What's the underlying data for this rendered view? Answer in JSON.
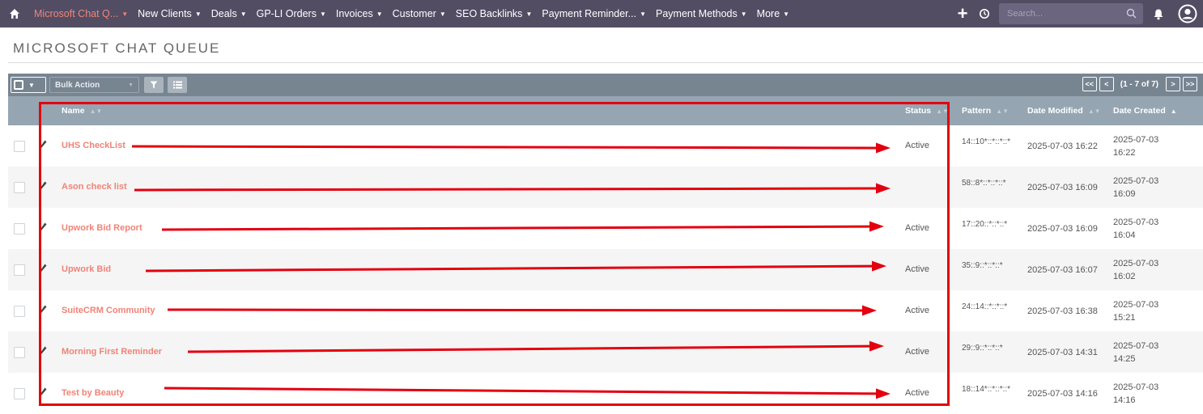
{
  "nav": {
    "items": [
      {
        "label": "Microsoft Chat Q...",
        "active": true
      },
      {
        "label": "New Clients"
      },
      {
        "label": "Deals"
      },
      {
        "label": "GP-LI Orders"
      },
      {
        "label": "Invoices"
      },
      {
        "label": "Customer"
      },
      {
        "label": "SEO Backlinks"
      },
      {
        "label": "Payment Reminder..."
      },
      {
        "label": "Payment Methods"
      },
      {
        "label": "More"
      }
    ],
    "search_placeholder": "Search..."
  },
  "page": {
    "title": "MICROSOFT CHAT QUEUE"
  },
  "toolbar": {
    "bulk_action_label": "Bulk Action",
    "pagination": {
      "first": "<<",
      "prev": "<",
      "count": "(1 - 7 of 7)",
      "next": ">",
      "last": ">>"
    }
  },
  "table": {
    "columns": [
      "Name",
      "Status",
      "Pattern",
      "Date Modified",
      "Date Created"
    ],
    "sorted_column": "Date Created",
    "rows": [
      {
        "name": "UHS CheckList",
        "status": "Active",
        "pattern": "14::10*::*::*::*",
        "modified": "2025-07-03 16:22",
        "created": "2025-07-03 16:22"
      },
      {
        "name": "Ason check list",
        "status": "",
        "pattern": "58::8*::*::*::*",
        "modified": "2025-07-03 16:09",
        "created": "2025-07-03 16:09"
      },
      {
        "name": "Upwork Bid Report",
        "status": "Active",
        "pattern": "17::20::*::*::*",
        "modified": "2025-07-03 16:09",
        "created": "2025-07-03 16:04"
      },
      {
        "name": "Upwork Bid",
        "status": "Active",
        "pattern": "35::9::*::*::*",
        "modified": "2025-07-03 16:07",
        "created": "2025-07-03 16:02"
      },
      {
        "name": "SuiteCRM Community",
        "status": "Active",
        "pattern": "24::14::*::*::*",
        "modified": "2025-07-03 16:38",
        "created": "2025-07-03 15:21"
      },
      {
        "name": "Morning First Reminder",
        "status": "Active",
        "pattern": "29::9::*::*::*",
        "modified": "2025-07-03 14:31",
        "created": "2025-07-03 14:25"
      },
      {
        "name": "Test by Beauty",
        "status": "Active",
        "pattern": "18::14*::*::*::*",
        "modified": "2025-07-03 14:16",
        "created": "2025-07-03 14:16"
      }
    ]
  },
  "annotation": {
    "color": "#e3000f"
  },
  "colors": {
    "nav_bg": "#534d64",
    "accent": "#f08377",
    "toolbar_bg": "#778591",
    "header_bg": "#95a5b1"
  },
  "icons": [
    "home-icon",
    "plus-icon",
    "history-icon",
    "search-icon",
    "bell-icon",
    "user-icon",
    "filter-icon",
    "column-chooser-icon",
    "pencil-icon"
  ]
}
